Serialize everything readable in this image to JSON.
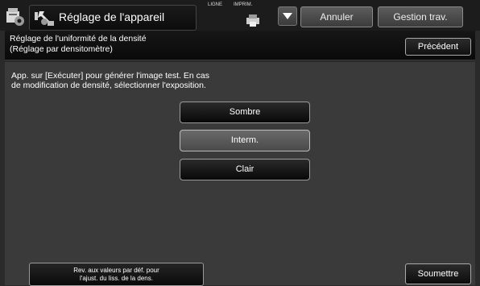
{
  "header": {
    "title": "Réglage de l'appareil",
    "ligne_label": "LIGNE",
    "imprim_label": "IMPRIM.",
    "cancel_label": "Annuler",
    "job_status_label": "Gestion trav."
  },
  "subheader": {
    "title_line1": "Réglage de l'uniformité de la densité",
    "title_line2": "(Réglage par densitomètre)",
    "back_label": "Précédent"
  },
  "main": {
    "instruction_line1": "App. sur [Exécuter] pour générer l'image test. En cas",
    "instruction_line2": "de modification de densité, sélectionner l'exposition.",
    "options": [
      {
        "label": "Sombre",
        "selected": false
      },
      {
        "label": "Interm.",
        "selected": true
      },
      {
        "label": "Clair",
        "selected": false
      }
    ],
    "reset_line1": "Rev. aux valeurs par déf. pour",
    "reset_line2": "l'ajust. du liss. de la dens.",
    "submit_label": "Soumettre"
  },
  "icons": {
    "app": "machine-settings-icon",
    "title": "wrench-settings-icon",
    "printer": "printer-icon",
    "dropdown": "triangle-down-icon"
  }
}
